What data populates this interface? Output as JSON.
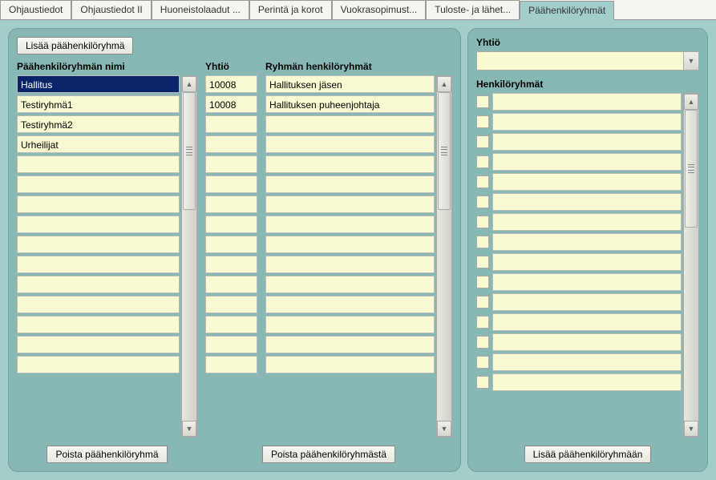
{
  "tabs": [
    {
      "label": "Ohjaustiedot"
    },
    {
      "label": "Ohjaustiedot II"
    },
    {
      "label": "Huoneistolaadut ..."
    },
    {
      "label": "Perintä ja korot"
    },
    {
      "label": "Vuokrasopimust..."
    },
    {
      "label": "Tuloste- ja lähet..."
    },
    {
      "label": "Päähenkilöryhmät",
      "active": true
    }
  ],
  "left": {
    "addButton": "Lisää päähenkilöryhmä",
    "nameHeader": "Päähenkilöryhmän nimi",
    "companyHeader": "Yhtiö",
    "groupsHeader": "Ryhmän henkilöryhmät",
    "removeGroupButton": "Poista päähenkilöryhmä",
    "removeFromGroupButton": "Poista päähenkilöryhmästä",
    "names": [
      {
        "value": "Hallitus",
        "selected": true
      },
      {
        "value": "Testiryhmä1"
      },
      {
        "value": "Testiryhmä2"
      },
      {
        "value": "Urheilijat"
      },
      {
        "value": ""
      },
      {
        "value": ""
      },
      {
        "value": ""
      },
      {
        "value": ""
      },
      {
        "value": ""
      },
      {
        "value": ""
      },
      {
        "value": ""
      },
      {
        "value": ""
      },
      {
        "value": ""
      },
      {
        "value": ""
      },
      {
        "value": ""
      }
    ],
    "details": [
      {
        "company": "10008",
        "group": "Hallituksen jäsen"
      },
      {
        "company": "10008",
        "group": "Hallituksen puheenjohtaja"
      },
      {
        "company": "",
        "group": ""
      },
      {
        "company": "",
        "group": ""
      },
      {
        "company": "",
        "group": ""
      },
      {
        "company": "",
        "group": ""
      },
      {
        "company": "",
        "group": ""
      },
      {
        "company": "",
        "group": ""
      },
      {
        "company": "",
        "group": ""
      },
      {
        "company": "",
        "group": ""
      },
      {
        "company": "",
        "group": ""
      },
      {
        "company": "",
        "group": ""
      },
      {
        "company": "",
        "group": ""
      },
      {
        "company": "",
        "group": ""
      },
      {
        "company": "",
        "group": ""
      }
    ]
  },
  "right": {
    "companyLabel": "Yhtiö",
    "personGroupsHeader": "Henkilöryhmät",
    "addToGroupButton": "Lisää päähenkilöryhmään",
    "rows": [
      {
        "checked": false,
        "value": ""
      },
      {
        "checked": false,
        "value": ""
      },
      {
        "checked": false,
        "value": ""
      },
      {
        "checked": false,
        "value": ""
      },
      {
        "checked": false,
        "value": ""
      },
      {
        "checked": false,
        "value": ""
      },
      {
        "checked": false,
        "value": ""
      },
      {
        "checked": false,
        "value": ""
      },
      {
        "checked": false,
        "value": ""
      },
      {
        "checked": false,
        "value": ""
      },
      {
        "checked": false,
        "value": ""
      },
      {
        "checked": false,
        "value": ""
      },
      {
        "checked": false,
        "value": ""
      },
      {
        "checked": false,
        "value": ""
      },
      {
        "checked": false,
        "value": ""
      }
    ]
  }
}
